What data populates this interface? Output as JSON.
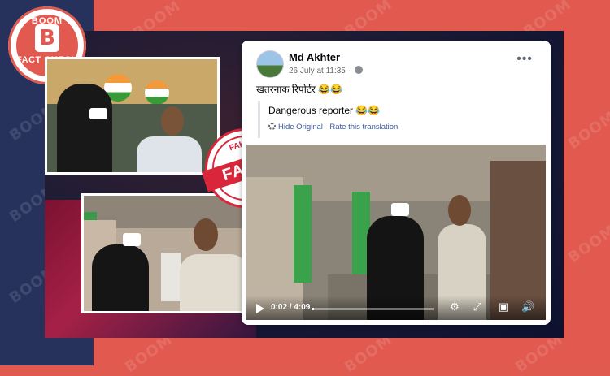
{
  "badge": {
    "top_text": "BOOM",
    "letter": "B",
    "bottom_text": "FACT CHECK"
  },
  "watermark": "BOOM",
  "stamp": {
    "main": "FAKE",
    "top": "FAKE",
    "bottom": "FAKE"
  },
  "post": {
    "author": "Md Akhter",
    "timestamp": "26 July at 11:35 ·",
    "text": "खतरनाक रिपोर्टर 😂😂",
    "translation": "Dangerous reporter 😂😂",
    "hide_original": "Hide Original",
    "separator": "·",
    "rate_translation": "Rate this translation",
    "more_icon": "more-icon",
    "video": {
      "time_display": "0:02 / 4:09",
      "progress": 0.01
    }
  },
  "colors": {
    "brand_red": "#e1594f",
    "navy": "#26315c",
    "link_blue": "#385898",
    "stamp_red": "#d9263a"
  }
}
